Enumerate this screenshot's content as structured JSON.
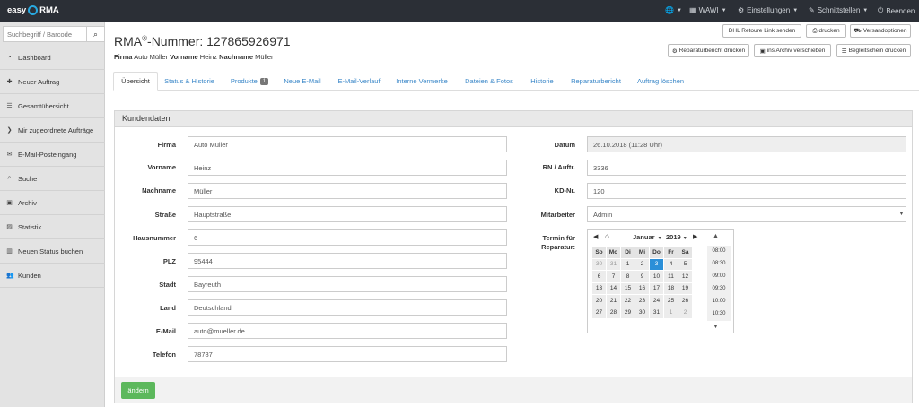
{
  "topbar": {
    "logo_left": "easy",
    "logo_right": "RMA",
    "nav": [
      {
        "label": "",
        "icon": "globe-icon"
      },
      {
        "label": "WAWI",
        "icon": "grid-icon"
      },
      {
        "label": "Einstellungen",
        "icon": "gear-icon"
      },
      {
        "label": "Schnittstellen",
        "icon": "wrench-icon"
      },
      {
        "label": "Beenden",
        "icon": "power-icon"
      }
    ]
  },
  "sidebar": {
    "search_placeholder": "Suchbegriff / Barcode",
    "items": [
      {
        "label": "Dashboard",
        "icon": "dashboard-icon"
      },
      {
        "label": "Neuer Auftrag",
        "icon": "plus-icon"
      },
      {
        "label": "Gesamtübersicht",
        "icon": "list-icon"
      },
      {
        "label": "Mir zugeordnete Aufträge",
        "icon": "chevron-right-icon"
      },
      {
        "label": "E-Mail-Posteingang",
        "icon": "envelope-icon"
      },
      {
        "label": "Suche",
        "icon": "search-icon"
      },
      {
        "label": "Archiv",
        "icon": "archive-icon"
      },
      {
        "label": "Statistik",
        "icon": "chart-icon"
      },
      {
        "label": "Neuen Status buchen",
        "icon": "barcode-icon"
      },
      {
        "label": "Kunden",
        "icon": "users-icon"
      }
    ]
  },
  "header": {
    "title_prefix": "RMA",
    "title_sup": "®",
    "title_suffix": "-Nummer: 127865926971",
    "sub": {
      "firma_label": "Firma",
      "firma_value": "Auto Müller",
      "vorname_label": "Vorname",
      "vorname_value": "Heinz",
      "nachname_label": "Nachname",
      "nachname_value": "Müller"
    }
  },
  "toolbar": {
    "dhl": "DHL Retoure Link senden",
    "print": "drucken",
    "shipping": "Versandoptionen",
    "repair_report_print": "Reparaturbericht drucken",
    "archive": "ins Archiv verschieben",
    "delivery_note": "Begleitschein drucken"
  },
  "tabs": [
    {
      "label": "Übersicht",
      "active": true
    },
    {
      "label": "Status & Historie"
    },
    {
      "label": "Produkte",
      "badge": "1"
    },
    {
      "label": "Neue E-Mail"
    },
    {
      "label": "E-Mail-Verlauf"
    },
    {
      "label": "Interne Vermerke"
    },
    {
      "label": "Dateien & Fotos"
    },
    {
      "label": "Historie"
    },
    {
      "label": "Reparaturbericht"
    },
    {
      "label": "Auftrag löschen"
    }
  ],
  "panel": {
    "title": "Kundendaten",
    "left_fields": [
      {
        "label": "Firma",
        "value": "Auto Müller"
      },
      {
        "label": "Vorname",
        "value": "Heinz"
      },
      {
        "label": "Nachname",
        "value": "Müller"
      },
      {
        "label": "Straße",
        "value": "Hauptstraße"
      },
      {
        "label": "Hausnummer",
        "value": "6"
      },
      {
        "label": "PLZ",
        "value": "95444"
      },
      {
        "label": "Stadt",
        "value": "Bayreuth"
      },
      {
        "label": "Land",
        "value": "Deutschland"
      },
      {
        "label": "E-Mail",
        "value": "auto@mueller.de"
      },
      {
        "label": "Telefon",
        "value": "78787"
      }
    ],
    "right_fields": [
      {
        "label": "Datum",
        "value": "26.10.2018 (11:28 Uhr)"
      },
      {
        "label": "RN / Auftr.",
        "value": "3336"
      },
      {
        "label": "KD-Nr.",
        "value": "120"
      },
      {
        "label": "Mitarbeiter",
        "value": "Admin"
      }
    ],
    "termin_label_1": "Termin für",
    "termin_label_2": "Reparatur:",
    "save_button": "ändern"
  },
  "calendar": {
    "month": "Januar",
    "year": "2019",
    "weekdays": [
      "So",
      "Mo",
      "Di",
      "Mi",
      "Do",
      "Fr",
      "Sa"
    ],
    "weeks": [
      [
        "30",
        "31",
        "1",
        "2",
        "3",
        "4",
        "5"
      ],
      [
        "6",
        "7",
        "8",
        "9",
        "10",
        "11",
        "12"
      ],
      [
        "13",
        "14",
        "15",
        "16",
        "17",
        "18",
        "19"
      ],
      [
        "20",
        "21",
        "22",
        "23",
        "24",
        "25",
        "26"
      ],
      [
        "27",
        "28",
        "29",
        "30",
        "31",
        "1",
        "2"
      ]
    ],
    "selected": "3",
    "times": [
      "08:00",
      "08:30",
      "09:00",
      "09:30",
      "10:00",
      "10:30"
    ]
  }
}
